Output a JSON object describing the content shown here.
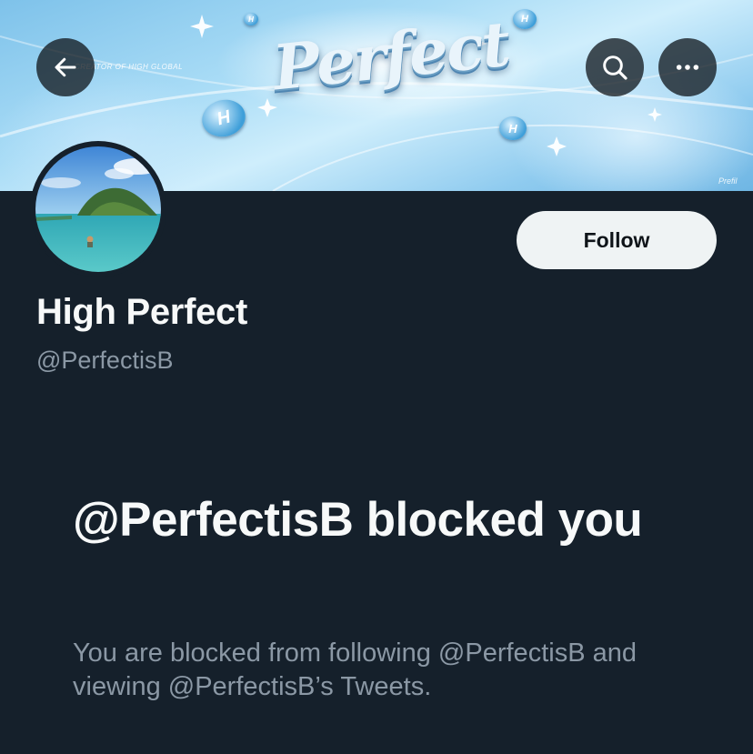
{
  "banner": {
    "wordmark": "Perfect",
    "tagline": "CREATOR OF HIGH GLOBAL",
    "credit": "Prefil"
  },
  "nav": {
    "back_icon": "arrow-left-icon",
    "search_icon": "search-icon",
    "more_icon": "more-horizontal-icon"
  },
  "profile": {
    "display_name": "High Perfect",
    "handle": "@PerfectisB",
    "follow_label": "Follow"
  },
  "blocked": {
    "title": "@PerfectisB blocked you",
    "description": "You are blocked from following @PerfectisB and viewing @PerfectisB’s Tweets."
  },
  "colors": {
    "background": "#15202b",
    "primary_text": "#f7f9f9",
    "secondary_text": "#8b98a5",
    "follow_button_bg": "#eff3f4",
    "follow_button_text": "#0f1419"
  }
}
